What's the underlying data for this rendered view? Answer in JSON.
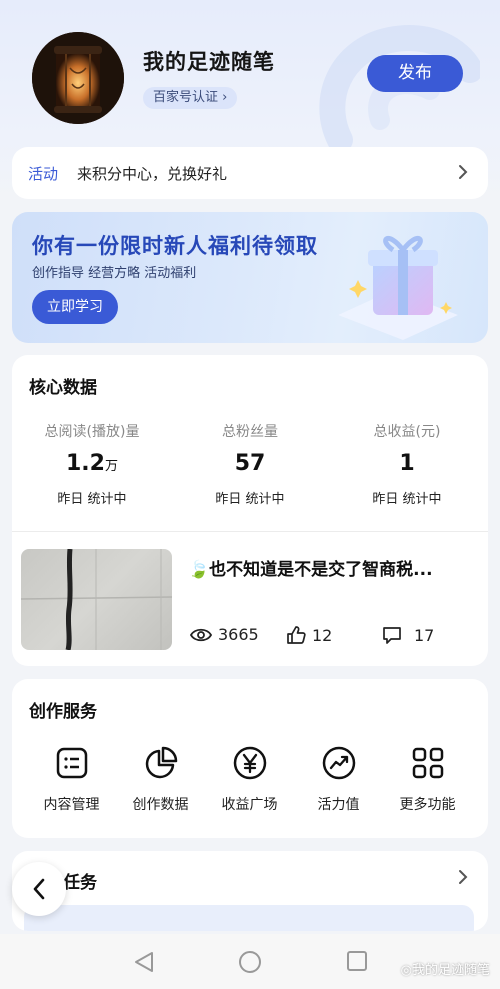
{
  "header": {
    "username": "我的足迹随笔",
    "cert_label": "百家号认证",
    "publish_label": "发布"
  },
  "activity": {
    "tag": "活动",
    "text": "来积分中心，兑换好礼"
  },
  "banner": {
    "title": "你有一份限时新人福利待领取",
    "subtitle": "创作指导 经营方略 活动福利",
    "button_label": "立即学习"
  },
  "core_data": {
    "title": "核心数据",
    "stats": [
      {
        "label": "总阅读(播放)量",
        "value": "1.2",
        "unit": "万",
        "sub": "昨日 统计中"
      },
      {
        "label": "总粉丝量",
        "value": "57",
        "unit": "",
        "sub": "昨日 统计中"
      },
      {
        "label": "总收益(元)",
        "value": "1",
        "unit": "",
        "sub": "昨日 统计中"
      }
    ],
    "article": {
      "title": "也不知道是不是交了智商税...",
      "views": "3665",
      "likes": "12",
      "comments": "17"
    }
  },
  "services": {
    "title": "创作服务",
    "items": [
      {
        "label": "内容管理",
        "icon": "content-list-icon"
      },
      {
        "label": "创作数据",
        "icon": "pie-chart-icon"
      },
      {
        "label": "收益广场",
        "icon": "yen-icon"
      },
      {
        "label": "活力值",
        "icon": "trend-icon"
      },
      {
        "label": "更多功能",
        "icon": "grid-icon"
      }
    ]
  },
  "tasks": {
    "title": "创作任务"
  },
  "watermark": "我的足迹随笔",
  "colors": {
    "accent": "#3a5ad6",
    "background": "#f2f4f8"
  }
}
